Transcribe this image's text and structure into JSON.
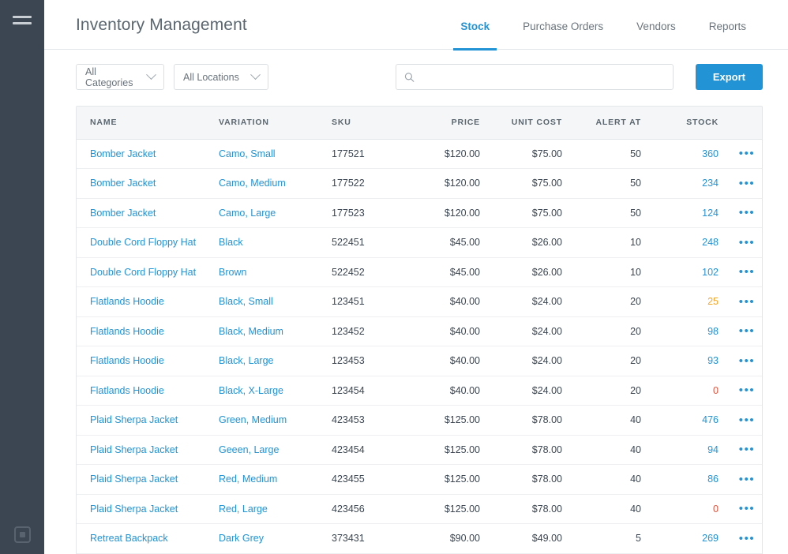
{
  "sidebar": {
    "menu_icon": "hamburger-icon",
    "bottom_icon": "app-square-icon"
  },
  "header": {
    "title": "Inventory Management",
    "tabs": [
      {
        "label": "Stock",
        "active": true
      },
      {
        "label": "Purchase Orders",
        "active": false
      },
      {
        "label": "Vendors",
        "active": false
      },
      {
        "label": "Reports",
        "active": false
      }
    ]
  },
  "toolbar": {
    "category_filter": "All Categories",
    "location_filter": "All Locations",
    "search_value": "",
    "search_placeholder": "",
    "search_icon": "search-icon",
    "export_label": "Export"
  },
  "table": {
    "columns": [
      "NAME",
      "VARIATION",
      "SKU",
      "PRICE",
      "UNIT COST",
      "ALERT AT",
      "STOCK"
    ],
    "rows": [
      {
        "name": "Bomber Jacket",
        "variation": "Camo, Small",
        "sku": "177521",
        "price": "$120.00",
        "unit_cost": "$75.00",
        "alert_at": "50",
        "stock": "360",
        "stock_state": "ok"
      },
      {
        "name": "Bomber Jacket",
        "variation": "Camo, Medium",
        "sku": "177522",
        "price": "$120.00",
        "unit_cost": "$75.00",
        "alert_at": "50",
        "stock": "234",
        "stock_state": "ok"
      },
      {
        "name": "Bomber Jacket",
        "variation": "Camo, Large",
        "sku": "177523",
        "price": "$120.00",
        "unit_cost": "$75.00",
        "alert_at": "50",
        "stock": "124",
        "stock_state": "ok"
      },
      {
        "name": "Double Cord Floppy Hat",
        "variation": "Black",
        "sku": "522451",
        "price": "$45.00",
        "unit_cost": "$26.00",
        "alert_at": "10",
        "stock": "248",
        "stock_state": "ok"
      },
      {
        "name": "Double Cord Floppy Hat",
        "variation": "Brown",
        "sku": "522452",
        "price": "$45.00",
        "unit_cost": "$26.00",
        "alert_at": "10",
        "stock": "102",
        "stock_state": "ok"
      },
      {
        "name": "Flatlands Hoodie",
        "variation": "Black, Small",
        "sku": "123451",
        "price": "$40.00",
        "unit_cost": "$24.00",
        "alert_at": "20",
        "stock": "25",
        "stock_state": "warn"
      },
      {
        "name": "Flatlands Hoodie",
        "variation": "Black, Medium",
        "sku": "123452",
        "price": "$40.00",
        "unit_cost": "$24.00",
        "alert_at": "20",
        "stock": "98",
        "stock_state": "ok"
      },
      {
        "name": "Flatlands Hoodie",
        "variation": "Black, Large",
        "sku": "123453",
        "price": "$40.00",
        "unit_cost": "$24.00",
        "alert_at": "20",
        "stock": "93",
        "stock_state": "ok"
      },
      {
        "name": "Flatlands Hoodie",
        "variation": "Black, X-Large",
        "sku": "123454",
        "price": "$40.00",
        "unit_cost": "$24.00",
        "alert_at": "20",
        "stock": "0",
        "stock_state": "out"
      },
      {
        "name": "Plaid Sherpa Jacket",
        "variation": "Green, Medium",
        "sku": "423453",
        "price": "$125.00",
        "unit_cost": "$78.00",
        "alert_at": "40",
        "stock": "476",
        "stock_state": "ok"
      },
      {
        "name": "Plaid Sherpa Jacket",
        "variation": "Geeen, Large",
        "sku": "423454",
        "price": "$125.00",
        "unit_cost": "$78.00",
        "alert_at": "40",
        "stock": "94",
        "stock_state": "ok"
      },
      {
        "name": "Plaid Sherpa Jacket",
        "variation": "Red, Medium",
        "sku": "423455",
        "price": "$125.00",
        "unit_cost": "$78.00",
        "alert_at": "40",
        "stock": "86",
        "stock_state": "ok"
      },
      {
        "name": "Plaid Sherpa Jacket",
        "variation": "Red, Large",
        "sku": "423456",
        "price": "$125.00",
        "unit_cost": "$78.00",
        "alert_at": "40",
        "stock": "0",
        "stock_state": "out"
      },
      {
        "name": "Retreat Backpack",
        "variation": "Dark Grey",
        "sku": "373431",
        "price": "$90.00",
        "unit_cost": "$49.00",
        "alert_at": "5",
        "stock": "269",
        "stock_state": "ok"
      }
    ],
    "row_action_label": "•••"
  },
  "colors": {
    "accent": "#2293d4",
    "sidebar": "#3b4652",
    "warning": "#f5a623",
    "danger": "#e8563f",
    "text": "#3b4652",
    "header_bg": "#f5f6f7"
  }
}
